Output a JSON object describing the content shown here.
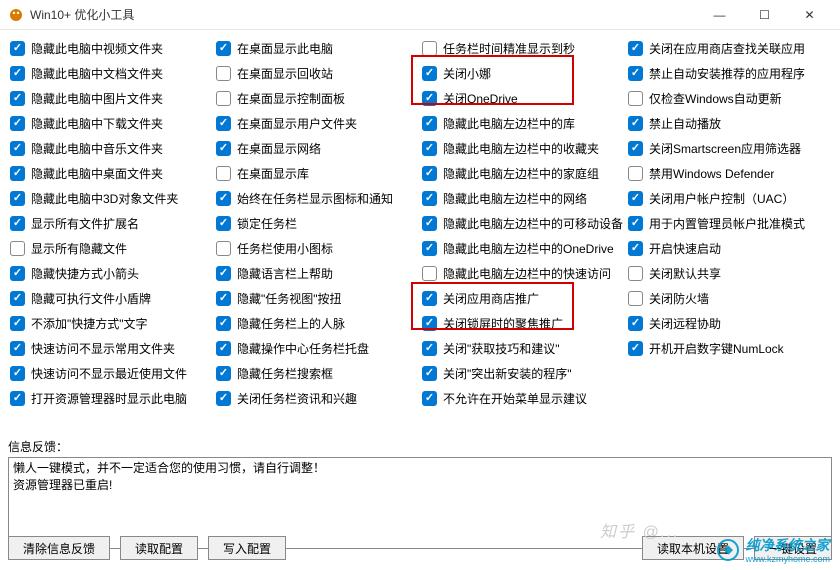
{
  "window": {
    "title": "Win10+ 优化小工具",
    "min": "—",
    "max": "☐",
    "close": "✕"
  },
  "columns": [
    [
      {
        "checked": true,
        "label": "隐藏此电脑中视频文件夹"
      },
      {
        "checked": true,
        "label": "隐藏此电脑中文档文件夹"
      },
      {
        "checked": true,
        "label": "隐藏此电脑中图片文件夹"
      },
      {
        "checked": true,
        "label": "隐藏此电脑中下载文件夹"
      },
      {
        "checked": true,
        "label": "隐藏此电脑中音乐文件夹"
      },
      {
        "checked": true,
        "label": "隐藏此电脑中桌面文件夹"
      },
      {
        "checked": true,
        "label": "隐藏此电脑中3D对象文件夹"
      },
      {
        "checked": true,
        "label": "显示所有文件扩展名"
      },
      {
        "checked": false,
        "label": "显示所有隐藏文件"
      },
      {
        "checked": true,
        "label": "隐藏快捷方式小箭头"
      },
      {
        "checked": true,
        "label": "隐藏可执行文件小盾牌"
      },
      {
        "checked": true,
        "label": "不添加\"快捷方式\"文字"
      },
      {
        "checked": true,
        "label": "快速访问不显示常用文件夹"
      },
      {
        "checked": true,
        "label": "快速访问不显示最近使用文件"
      },
      {
        "checked": true,
        "label": "打开资源管理器时显示此电脑"
      }
    ],
    [
      {
        "checked": true,
        "label": "在桌面显示此电脑"
      },
      {
        "checked": false,
        "label": "在桌面显示回收站"
      },
      {
        "checked": false,
        "label": "在桌面显示控制面板"
      },
      {
        "checked": true,
        "label": "在桌面显示用户文件夹"
      },
      {
        "checked": true,
        "label": "在桌面显示网络"
      },
      {
        "checked": false,
        "label": "在桌面显示库"
      },
      {
        "checked": true,
        "label": "始终在任务栏显示图标和通知"
      },
      {
        "checked": true,
        "label": "锁定任务栏"
      },
      {
        "checked": false,
        "label": "任务栏使用小图标"
      },
      {
        "checked": true,
        "label": "隐藏语言栏上帮助"
      },
      {
        "checked": true,
        "label": "隐藏\"任务视图\"按扭"
      },
      {
        "checked": true,
        "label": "隐藏任务栏上的人脉"
      },
      {
        "checked": true,
        "label": "隐藏操作中心任务栏托盘"
      },
      {
        "checked": true,
        "label": "隐藏任务栏搜索框"
      },
      {
        "checked": true,
        "label": "关闭任务栏资讯和兴趣"
      }
    ],
    [
      {
        "checked": false,
        "label": "任务栏时间精准显示到秒"
      },
      {
        "checked": true,
        "label": "关闭小娜"
      },
      {
        "checked": true,
        "label": "关闭OneDrive"
      },
      {
        "checked": true,
        "label": "隐藏此电脑左边栏中的库"
      },
      {
        "checked": true,
        "label": "隐藏此电脑左边栏中的收藏夹"
      },
      {
        "checked": true,
        "label": "隐藏此电脑左边栏中的家庭组"
      },
      {
        "checked": true,
        "label": "隐藏此电脑左边栏中的网络"
      },
      {
        "checked": true,
        "label": "隐藏此电脑左边栏中的可移动设备"
      },
      {
        "checked": true,
        "label": "隐藏此电脑左边栏中的OneDrive"
      },
      {
        "checked": false,
        "label": "隐藏此电脑左边栏中的快速访问"
      },
      {
        "checked": true,
        "label": "关闭应用商店推广"
      },
      {
        "checked": true,
        "label": "关闭锁屏时的聚焦推广"
      },
      {
        "checked": true,
        "label": "关闭\"获取技巧和建议\""
      },
      {
        "checked": true,
        "label": "关闭\"突出新安装的程序\""
      },
      {
        "checked": true,
        "label": "不允许在开始菜单显示建议"
      }
    ],
    [
      {
        "checked": true,
        "label": "关闭在应用商店查找关联应用"
      },
      {
        "checked": true,
        "label": "禁止自动安装推荐的应用程序"
      },
      {
        "checked": false,
        "label": "仅检查Windows自动更新"
      },
      {
        "checked": true,
        "label": "禁止自动播放"
      },
      {
        "checked": true,
        "label": "关闭Smartscreen应用筛选器"
      },
      {
        "checked": false,
        "label": "禁用Windows Defender"
      },
      {
        "checked": true,
        "label": "关闭用户帐户控制（UAC）"
      },
      {
        "checked": true,
        "label": "用于内置管理员帐户批准模式"
      },
      {
        "checked": true,
        "label": "开启快速启动"
      },
      {
        "checked": false,
        "label": "关闭默认共享"
      },
      {
        "checked": false,
        "label": "关闭防火墙"
      },
      {
        "checked": true,
        "label": "关闭远程协助"
      },
      {
        "checked": true,
        "label": "开机开启数字键NumLock"
      }
    ]
  ],
  "feedback": {
    "label": "信息反馈：",
    "text": "懒人一键模式，并不一定适合您的使用习惯，请自行调整！\n资源管理器已重启!"
  },
  "buttons": {
    "clear": "清除信息反馈",
    "read_cfg": "读取配置",
    "write_cfg": "写入配置",
    "read_local": "读取本机设置",
    "one_click": "一键设置"
  },
  "watermark": {
    "main": "纯净系统之家",
    "sub": "www.kzmyhome.com",
    "faint": "知乎 @..."
  }
}
